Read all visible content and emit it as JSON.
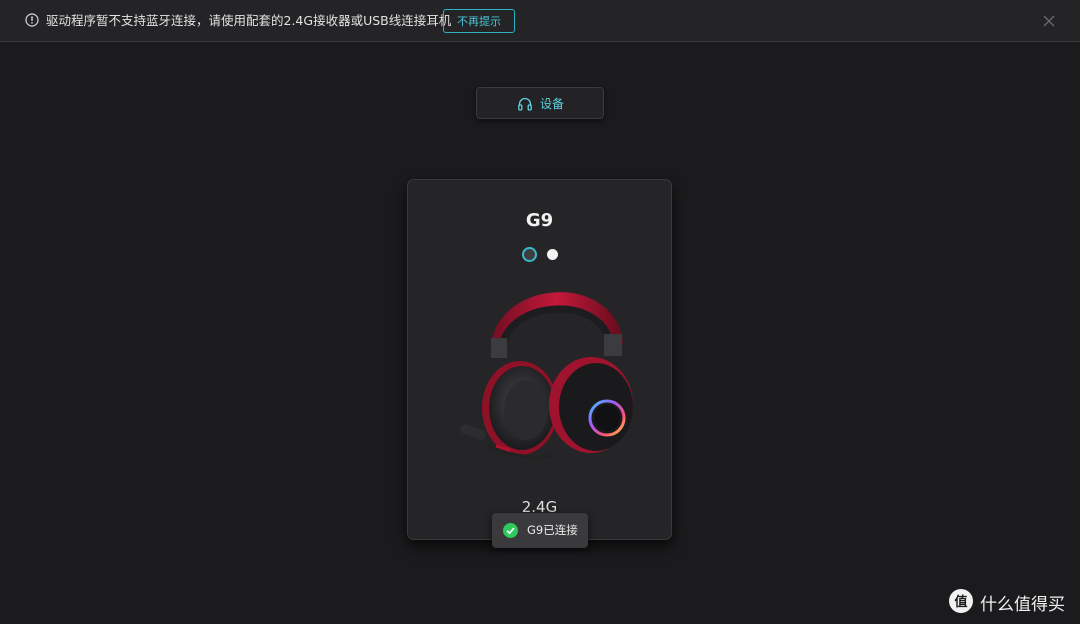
{
  "banner": {
    "message": "驱动程序暂不支持蓝牙连接，请使用配套的2.4G接收器或USB线连接耳机",
    "dismiss_label": "不再提示",
    "info_icon": "info-circle-icon",
    "close_icon": "close-icon"
  },
  "device_button": {
    "label": "设备",
    "icon": "headphones-icon"
  },
  "device_card": {
    "name": "G9",
    "connection_mode": "2.4G",
    "color_options": [
      "dark-teal-selected",
      "white"
    ]
  },
  "toast": {
    "text": "G9已连接",
    "icon": "check-circle-icon"
  },
  "watermark": {
    "text": "什么值得买",
    "icon": "smzdm-logo-icon"
  },
  "colors": {
    "accent": "#2bb3c6",
    "background": "#1b1b1d",
    "card": "#252527",
    "success": "#2ec95c"
  }
}
